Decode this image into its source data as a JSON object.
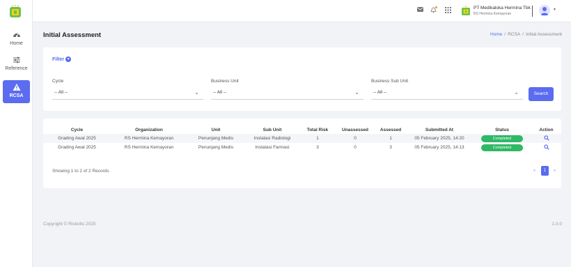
{
  "sidebar": {
    "items": [
      {
        "label": "Home",
        "icon": "dashboard-gauge-icon"
      },
      {
        "label": "Reference",
        "icon": "sliders-icon"
      },
      {
        "label": "RCSA",
        "icon": "warning-triangle-icon",
        "active": true
      }
    ]
  },
  "topbar": {
    "icons": [
      "mail-icon",
      "bell-icon",
      "apps-grid-icon"
    ],
    "company_name": "PT Medikaloka Hermina Tbk",
    "company_sub": "RS Hermina Kemayoran"
  },
  "page": {
    "title": "Initial Assessment",
    "breadcrumb": [
      "Home",
      "RCSA",
      "Initial Assessment"
    ],
    "breadcrumb_sep": "/"
  },
  "filter": {
    "title": "Filter",
    "fields": [
      {
        "label": "Cycle",
        "value": "-- All --"
      },
      {
        "label": "Business Unit",
        "value": "-- All --"
      },
      {
        "label": "Business Sub Unit",
        "value": "-- All --"
      }
    ],
    "search_label": "Search"
  },
  "table": {
    "headers": [
      "Cycle",
      "Organization",
      "Unit",
      "Sub Unit",
      "Total Risk",
      "Unassessed",
      "Assessed",
      "Submitted At",
      "Status",
      "Action"
    ],
    "rows": [
      [
        "Grading Awal 2025",
        "RS Hermina Kemayoran",
        "Penunjang Medis",
        "Instalasi Radiologi",
        "1",
        "0",
        "1",
        "05 February 2025, 14:20",
        "Completed"
      ],
      [
        "Grading Awal 2025",
        "RS Hermina Kemayoran",
        "Penunjang Medis",
        "Instalasi Farmasi",
        "3",
        "0",
        "3",
        "05 February 2025, 14:13",
        "Completed"
      ]
    ],
    "records_text": "Showing 1 to 2 of 2 Records",
    "pager": {
      "prev": "«",
      "page": "1",
      "next": "»"
    }
  },
  "footer": {
    "copyright": "Copyright © Riskobs 2025",
    "version": "1.0.0"
  },
  "colors": {
    "accent": "#5b6cf0",
    "status_completed": "#2fb865",
    "logo_green": "#6cc24a",
    "logo_yellow": "#f2d21c"
  }
}
